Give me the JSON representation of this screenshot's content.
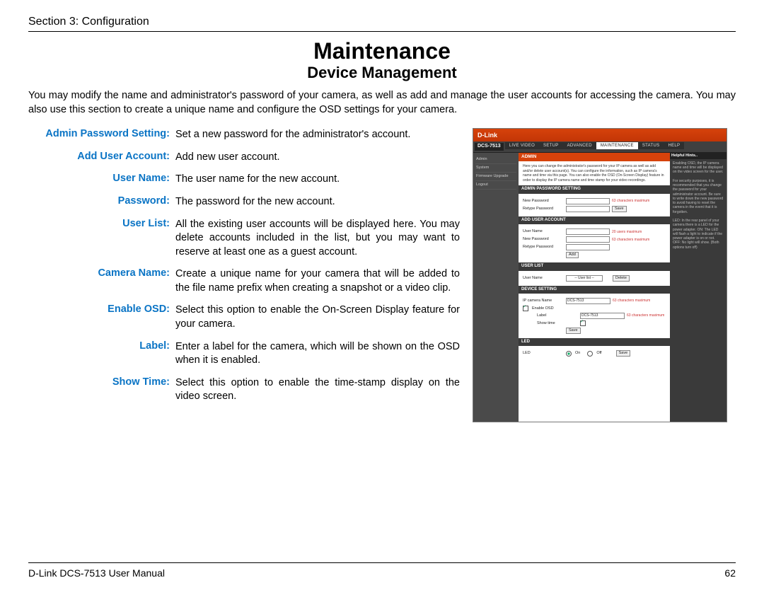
{
  "header": {
    "section": "Section 3: Configuration"
  },
  "titles": {
    "main": "Maintenance",
    "sub": "Device Management"
  },
  "intro": "You may modify the name and administrator's password of your camera, as well as add and manage the user accounts for accessing the camera. You may also use this section to create a unique name and configure the OSD settings for your camera.",
  "defs": [
    {
      "term": "Admin Password Setting:",
      "desc": "Set a new password for the administrator's account."
    },
    {
      "term": "Add User Account:",
      "desc": "Add new user account."
    },
    {
      "term": "User Name:",
      "desc": "The user name for the new account."
    },
    {
      "term": "Password:",
      "desc": "The password for the new account."
    },
    {
      "term": "User List:",
      "desc": "All the existing user accounts will be displayed here. You may delete accounts included in the list, but you may want to reserve at least one as a guest account."
    },
    {
      "term": "Camera Name:",
      "desc": "Create a unique name for your camera that will be added to the file name prefix when creating a snapshot or a video clip."
    },
    {
      "term": "Enable OSD:",
      "desc": "Select this option to enable the On-Screen Display feature for your camera."
    },
    {
      "term": "Label:",
      "desc": "Enter a label for the camera, which will be shown on the OSD when it is enabled."
    },
    {
      "term": "Show Time:",
      "desc": "Select this option to enable the time-stamp display on the video screen."
    }
  ],
  "footer": {
    "left": "D-Link DCS-7513 User Manual",
    "right": "62"
  },
  "scr": {
    "brand": "D-Link",
    "model": "DCS-7513",
    "tabs": [
      "LIVE VIDEO",
      "SETUP",
      "ADVANCED",
      "MAINTENANCE",
      "STATUS",
      "HELP"
    ],
    "activeTab": "MAINTENANCE",
    "side": [
      "Admin",
      "System",
      "Firmware Upgrade",
      "Logout"
    ],
    "hintsTitle": "Helpful Hints..",
    "hints": "Enabling OSD, the IP camera name and time will be displayed on the video screen for the user.\n\nFor security purposes, it is recommended that you change the password for your administrator account. Be sure to write down the new password to avoid having to reset the camera in the event that it is forgotten.\n\nLED: In the rear panel of your camera there is a LED for the power adapter. ON: The LED will flash a light to indicate if the power adapter is on or not. OFF: No light will show. (Both options turn off)",
    "admin": {
      "title": "ADMIN",
      "text": "Here you can change the administrator's password for your IP camera as well as add and/or delete user account(s). You can configure the information, such as IP camera's name and time via this page. You can also enable the OSD (On-Screen Display) feature in order to display the IP camera name and time stamp for your video recordings."
    },
    "pw": {
      "title": "ADMIN PASSWORD SETTING",
      "f1": "New Password",
      "f2": "Retype Password",
      "note": "63 characters maximum",
      "btn": "Save"
    },
    "add": {
      "title": "ADD USER ACCOUNT",
      "f1": "User Name",
      "f2": "New Password",
      "f3": "Retype Password",
      "note1": "20 users maximum",
      "note2": "63 characters maximum",
      "btn": "Add"
    },
    "list": {
      "title": "USER LIST",
      "f1": "User Name",
      "sel": "-- User list --",
      "btn": "Delete"
    },
    "dev": {
      "title": "DEVICE SETTING",
      "f1": "IP camera Name",
      "v1": "DCS-7513",
      "cb": "Enable OSD",
      "f2": "Label",
      "v2": "DCS-7513",
      "f3": "Show time",
      "note": "63 characters maximum",
      "btn": "Save"
    },
    "led": {
      "title": "LED",
      "f1": "LED",
      "on": "On",
      "off": "Off",
      "btn": "Save"
    }
  }
}
